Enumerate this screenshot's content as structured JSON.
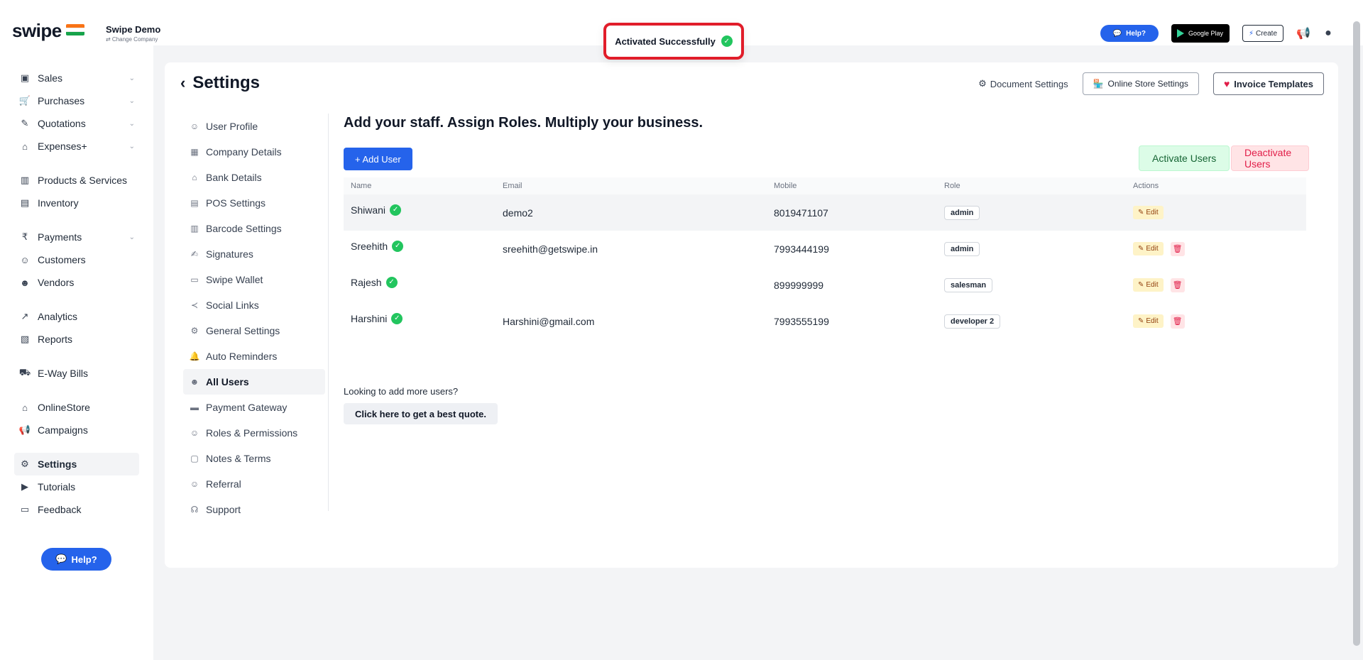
{
  "brand": {
    "logo": "swipe",
    "company_name": "Swipe Demo",
    "company_sub": "⇄ Change Company"
  },
  "toast": {
    "message": "Activated Successfully"
  },
  "topbar": {
    "help_label": "Help?",
    "google_play_top": "GET IT ON",
    "google_play_label": "Google Play",
    "create_label": "Create"
  },
  "sidebar": {
    "items": [
      {
        "label": "Sales",
        "icon": "sales-icon",
        "chevron": true
      },
      {
        "label": "Purchases",
        "icon": "cart-icon",
        "chevron": true
      },
      {
        "label": "Quotations",
        "icon": "pencil-icon",
        "chevron": true
      },
      {
        "label": "Expenses+",
        "icon": "tag-icon",
        "chevron": true
      },
      {
        "label": "Products & Services",
        "icon": "barcode-icon",
        "chevron": false
      },
      {
        "label": "Inventory",
        "icon": "inventory-icon",
        "chevron": false
      },
      {
        "label": "Payments",
        "icon": "rupee-icon",
        "chevron": true
      },
      {
        "label": "Customers",
        "icon": "user-icon",
        "chevron": false
      },
      {
        "label": "Vendors",
        "icon": "users-icon",
        "chevron": false
      },
      {
        "label": "Analytics",
        "icon": "chart-icon",
        "chevron": false
      },
      {
        "label": "Reports",
        "icon": "report-icon",
        "chevron": false
      },
      {
        "label": "E-Way Bills",
        "icon": "truck-icon",
        "chevron": false
      },
      {
        "label": "OnlineStore",
        "icon": "store-icon",
        "chevron": false
      },
      {
        "label": "Campaigns",
        "icon": "megaphone-icon",
        "chevron": false
      },
      {
        "label": "Settings",
        "icon": "gear-icon",
        "chevron": false
      },
      {
        "label": "Tutorials",
        "icon": "youtube-icon",
        "chevron": false
      },
      {
        "label": "Feedback",
        "icon": "chat-icon",
        "chevron": false
      }
    ],
    "help_label": "Help?"
  },
  "settings": {
    "title": "Settings",
    "document_settings": "Document Settings",
    "online_store_settings": "Online Store Settings",
    "invoice_templates": "Invoice Templates",
    "subnav": [
      {
        "label": "User Profile",
        "icon": "user-icon"
      },
      {
        "label": "Company Details",
        "icon": "building-icon"
      },
      {
        "label": "Bank Details",
        "icon": "bank-icon"
      },
      {
        "label": "POS Settings",
        "icon": "pos-icon"
      },
      {
        "label": "Barcode Settings",
        "icon": "barcode-icon"
      },
      {
        "label": "Signatures",
        "icon": "signature-icon"
      },
      {
        "label": "Swipe Wallet",
        "icon": "wallet-icon"
      },
      {
        "label": "Social Links",
        "icon": "share-icon"
      },
      {
        "label": "General Settings",
        "icon": "gear-icon"
      },
      {
        "label": "Auto Reminders",
        "icon": "bell-icon"
      },
      {
        "label": "All Users",
        "icon": "users-icon"
      },
      {
        "label": "Payment Gateway",
        "icon": "card-icon"
      },
      {
        "label": "Roles & Permissions",
        "icon": "roles-icon"
      },
      {
        "label": "Notes & Terms",
        "icon": "note-icon"
      },
      {
        "label": "Referral",
        "icon": "referral-icon"
      },
      {
        "label": "Support",
        "icon": "headset-icon"
      }
    ]
  },
  "users": {
    "heading": "Add your staff. Assign Roles. Multiply your business.",
    "add_user": "+ Add User",
    "activate_users": "Activate Users",
    "deactivate_users": "Deactivate Users",
    "columns": {
      "name": "Name",
      "email": "Email",
      "mobile": "Mobile",
      "role": "Role",
      "actions": "Actions"
    },
    "rows": [
      {
        "name": "Shiwani",
        "email": "demo2",
        "mobile": "8019471107",
        "role": "admin",
        "deletable": false
      },
      {
        "name": "Sreehith",
        "email": "sreehith@getswipe.in",
        "mobile": "7993444199",
        "role": "admin",
        "deletable": true
      },
      {
        "name": "Rajesh",
        "email": "",
        "mobile": "899999999",
        "role": "salesman",
        "deletable": true
      },
      {
        "name": "Harshini",
        "email": "Harshini@gmail.com",
        "mobile": "7993555199",
        "role": "developer 2",
        "deletable": true
      }
    ],
    "edit_label": "Edit",
    "more_users_text": "Looking to add more users?",
    "quote_button": "Click here to get a best quote."
  },
  "colors": {
    "primary": "#2563eb",
    "success": "#22c55e",
    "danger": "#e11d48",
    "toast_border": "#e11d2a"
  }
}
